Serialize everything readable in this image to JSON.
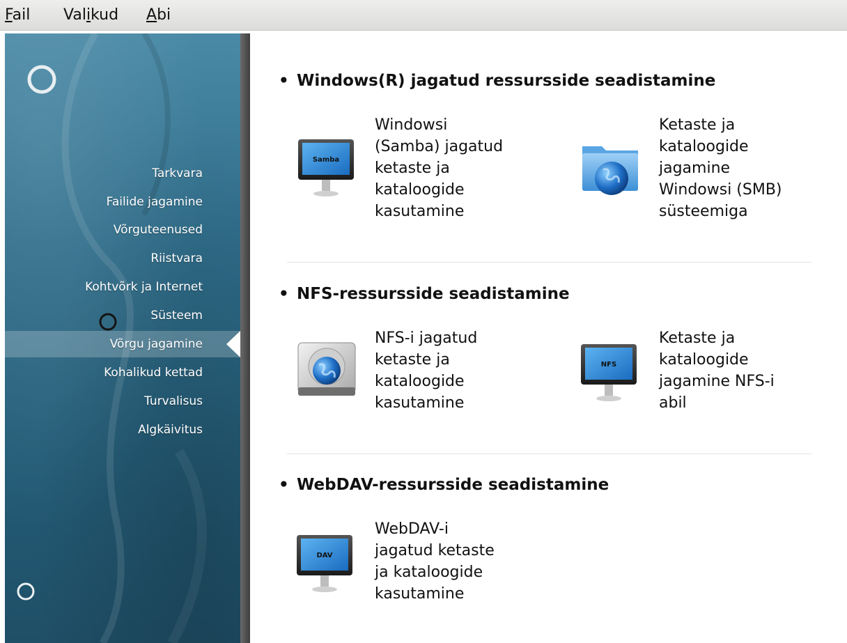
{
  "menubar": {
    "items": [
      {
        "accel": "F",
        "rest": "ail"
      },
      {
        "pre": "Val",
        "accel": "i",
        "rest": "kud"
      },
      {
        "accel": "A",
        "rest": "bi"
      }
    ]
  },
  "sidebar": {
    "items": [
      {
        "label": "Tarkvara"
      },
      {
        "label": "Failide jagamine"
      },
      {
        "label": "Võrguteenused"
      },
      {
        "label": "Riistvara"
      },
      {
        "label": "Kohtvõrk ja Internet"
      },
      {
        "label": "Süsteem"
      },
      {
        "label": "Võrgu jagamine",
        "selected": true
      },
      {
        "label": "Kohalikud kettad"
      },
      {
        "label": "Turvalisus"
      },
      {
        "label": "Algkäivitus"
      }
    ]
  },
  "sections": [
    {
      "title": "Windows(R) jagatud ressursside seadistamine",
      "items": [
        {
          "label": "Windowsi\n(Samba) jagatud\nketaste ja\nkataloogide\nkasutamine",
          "icon": "monitor-icon",
          "icon_text": "Samba"
        },
        {
          "label": "Ketaste ja\nkataloogide\njagamine\nWindowsi (SMB)\nsüsteemiga",
          "icon": "folder-globe-icon"
        }
      ]
    },
    {
      "title": "NFS-ressursside seadistamine",
      "items": [
        {
          "label": "NFS-i jagatud\nketaste ja\nkataloogide\nkasutamine",
          "icon": "harddisk-globe-icon"
        },
        {
          "label": "Ketaste ja\nkataloogide\njagamine NFS-i\nabil",
          "icon": "monitor-icon",
          "icon_text": "NFS"
        }
      ]
    },
    {
      "title": "WebDAV-ressursside seadistamine",
      "items": [
        {
          "label": "WebDAV-i\njagatud ketaste\nja kataloogide\nkasutamine",
          "icon": "monitor-icon",
          "icon_text": "DAV"
        }
      ]
    }
  ],
  "colors": {
    "sidebar": "#2f6d8a",
    "screen_blue": "#2a86d6",
    "text": "#111111"
  }
}
